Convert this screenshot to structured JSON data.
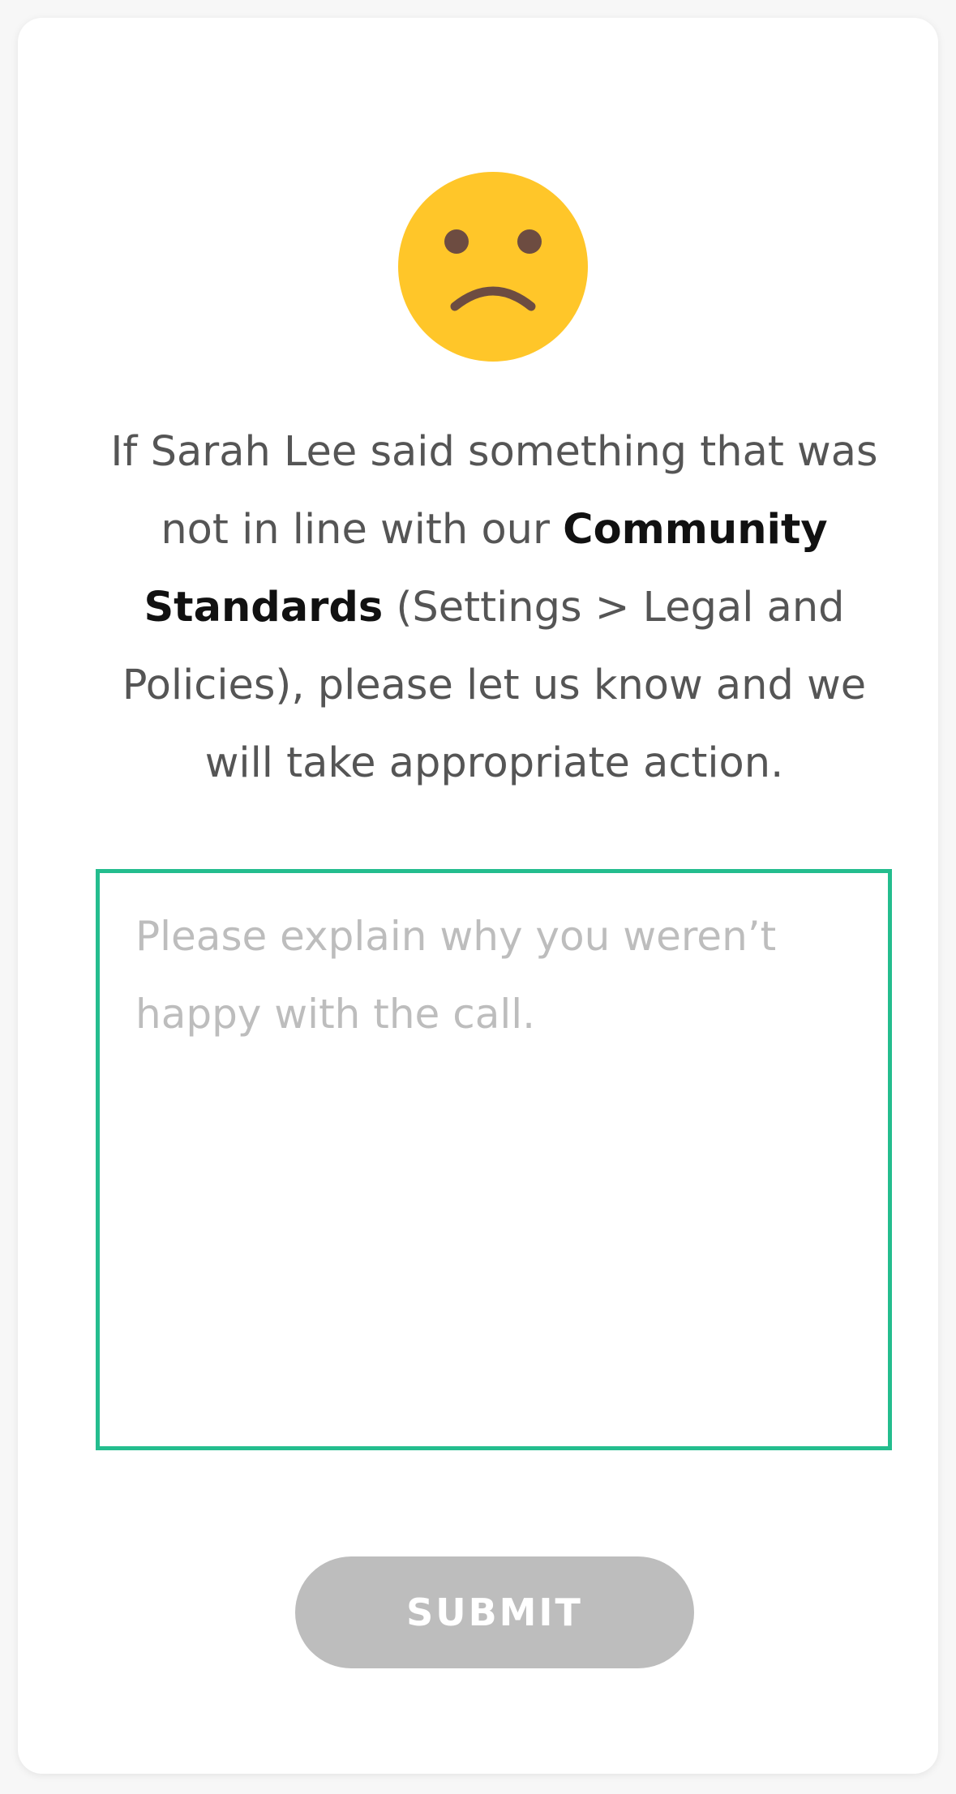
{
  "icon": {
    "name": "sad-face-icon",
    "face_color": "#FFC629",
    "feature_color": "#6D4C41"
  },
  "message": {
    "part1": "If Sarah Lee said something that was not in line with our ",
    "bold": "Community Standards",
    "part2": " (Settings > Legal and Policies), please let us know and we will take appropriate action."
  },
  "feedback": {
    "value": "",
    "placeholder": "Please explain why you weren’t happy with the call.",
    "border_color": "#24BD8E"
  },
  "submit": {
    "label": "SUBMIT",
    "color": "#BDBDBD"
  }
}
